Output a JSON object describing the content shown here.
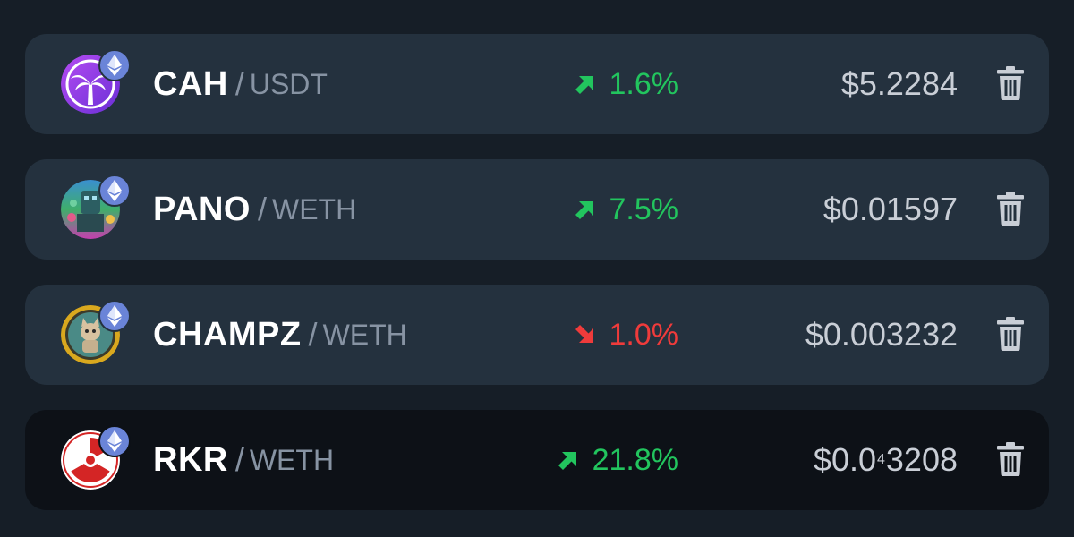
{
  "watchlist": {
    "items": [
      {
        "base": "CAH",
        "quote": "USDT",
        "change": "1.6%",
        "direction": "up",
        "price": "$5.2284",
        "token_icon": "palm-tree-token-icon",
        "chain_icon": "ethereum-icon"
      },
      {
        "base": "PANO",
        "quote": "WETH",
        "change": "7.5%",
        "direction": "up",
        "price": "$0.01597",
        "token_icon": "pano-token-icon",
        "chain_icon": "ethereum-icon"
      },
      {
        "base": "CHAMPZ",
        "quote": "WETH",
        "change": "1.0%",
        "direction": "down",
        "price": "$0.003232",
        "token_icon": "champz-token-icon",
        "chain_icon": "ethereum-icon"
      },
      {
        "base": "RKR",
        "quote": "WETH",
        "change": "21.8%",
        "direction": "up",
        "price_prefix": "$0.0",
        "price_zeros": "4",
        "price_digits": "3208",
        "token_icon": "radiation-token-icon",
        "chain_icon": "ethereum-icon"
      }
    ]
  },
  "colors": {
    "background": "#161e27",
    "row": "#24313e",
    "row_highlight": "#0d1117",
    "positive": "#22c55e",
    "negative": "#ef3b3b",
    "eth_badge": "#6a84d8"
  },
  "icons": {
    "delete": "trash-icon",
    "up": "arrow-up-right-icon",
    "down": "arrow-down-right-icon"
  }
}
